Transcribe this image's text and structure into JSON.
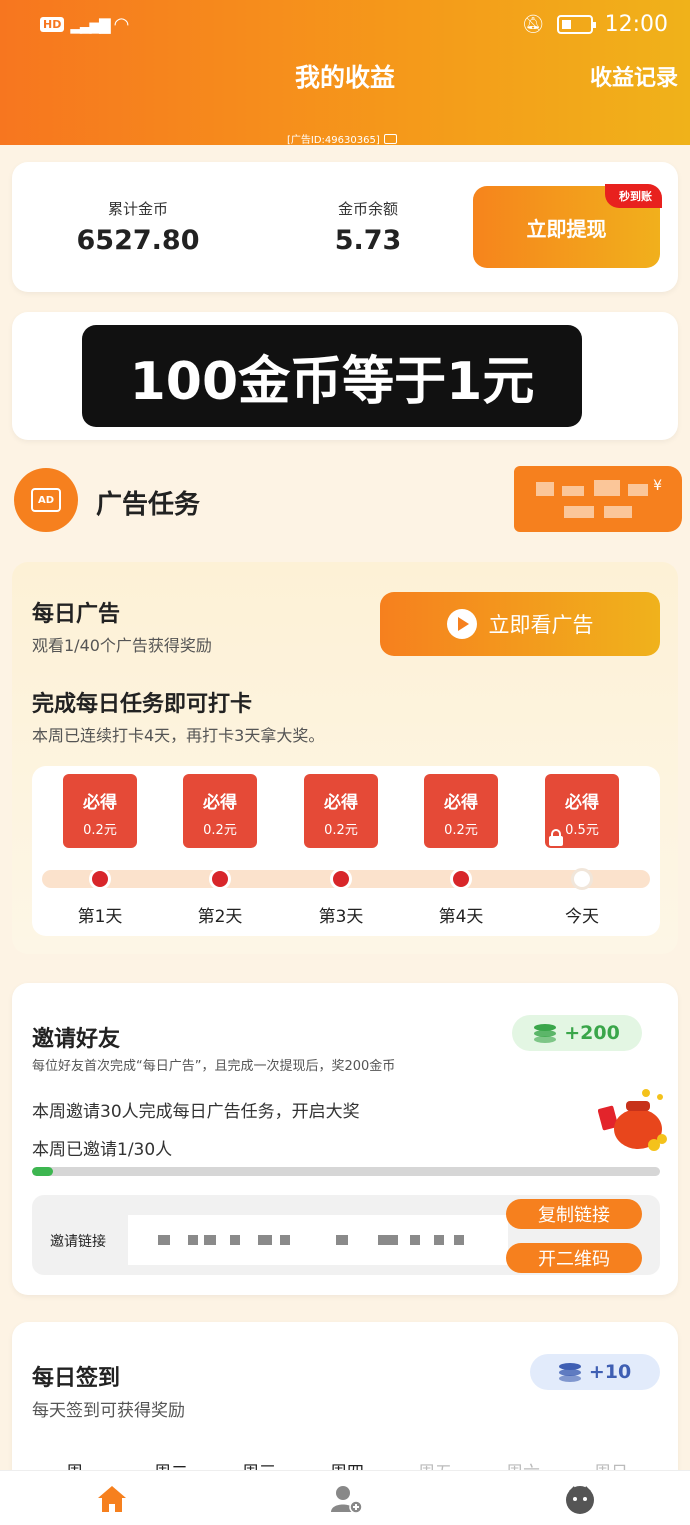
{
  "status_bar": {
    "network": "HD",
    "signal": "5G",
    "time": "12:00"
  },
  "header": {
    "title": "我的收益",
    "records_link": "收益记录",
    "ad_id": "[广告ID:49630365]"
  },
  "stats": {
    "total_coins_label": "累计金币",
    "total_coins_value": "6527.80",
    "balance_label": "金币余额",
    "balance_value": "5.73",
    "withdraw_label": "立即提现",
    "instant_badge": "秒到账"
  },
  "overlay_text": "100金币等于1元",
  "ad_task": {
    "icon_text": "AD",
    "title": "广告任务",
    "badge_currency": "¥"
  },
  "daily_ad": {
    "title": "每日广告",
    "subtitle": "观看1/40个广告获得奖励",
    "watch_button": "立即看广告",
    "checkin_title": "完成每日任务即可打卡",
    "checkin_subtitle": "本周已连续打卡4天，再打卡3天拿大奖。",
    "rewards": [
      {
        "label": "必得",
        "amount": "0.2元",
        "day": "第1天",
        "done": true
      },
      {
        "label": "必得",
        "amount": "0.2元",
        "day": "第2天",
        "done": true
      },
      {
        "label": "必得",
        "amount": "0.2元",
        "day": "第3天",
        "done": true
      },
      {
        "label": "必得",
        "amount": "0.2元",
        "day": "第4天",
        "done": true
      },
      {
        "label": "必得",
        "amount": "0.5元",
        "day": "今天",
        "done": false
      }
    ]
  },
  "invite": {
    "title": "邀请好友",
    "reward_badge": "+200",
    "rule": "每位好友首次完成“每日广告”，且完成一次提现后，奖200金币",
    "weekly_goal": "本周邀请30人完成每日广告任务，开启大奖",
    "progress_text": "本周已邀请1/30人",
    "progress": 0.033,
    "link_label": "邀请链接",
    "copy_button": "复制链接",
    "qr_button": "开二维码"
  },
  "sign_in": {
    "title": "每日签到",
    "reward_badge": "+10",
    "subtitle": "每天签到可获得奖励",
    "weekdays": [
      "周一",
      "周二",
      "周三",
      "周四",
      "周五",
      "周六",
      "周日"
    ]
  },
  "colors": {
    "primary": "#f6801e",
    "accent_red": "#e54a37",
    "success": "#3db650"
  }
}
